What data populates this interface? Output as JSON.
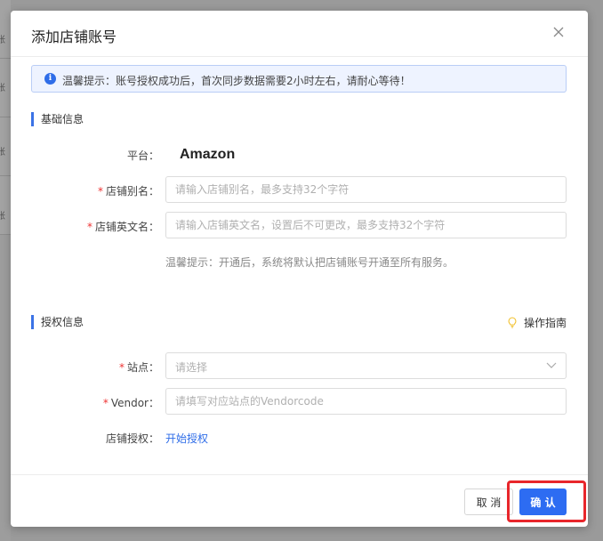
{
  "background": {
    "edge_chars": [
      "账",
      "账",
      "账",
      "账"
    ]
  },
  "modal": {
    "title": "添加店铺账号",
    "close_icon": "close-icon"
  },
  "alert": {
    "icon": "info-icon",
    "text": "温馨提示：账号授权成功后，首次同步数据需要2小时左右，请耐心等待！"
  },
  "basic_section": {
    "title": "基础信息",
    "platform_label": "平台：",
    "platform_value": "Amazon",
    "alias_label": "店铺别名：",
    "alias_placeholder": "请输入店铺别名，最多支持32个字符",
    "english_label": "店铺英文名：",
    "english_placeholder": "请输入店铺英文名，设置后不可更改，最多支持32个字符",
    "tip": "温馨提示：开通后，系统将默认把店铺账号开通至所有服务。"
  },
  "auth_section": {
    "title": "授权信息",
    "guide_label": "操作指南",
    "guide_icon": "lightbulb-icon",
    "site_label": "站点：",
    "site_placeholder": "请选择",
    "vendor_label": "Vendor：",
    "vendor_placeholder": "请填写对应站点的Vendorcode",
    "store_auth_label": "店铺授权：",
    "store_auth_link": "开始授权"
  },
  "footer": {
    "cancel_label": "取 消",
    "confirm_label": "确 认"
  },
  "colors": {
    "primary": "#2d6cf2",
    "required": "#e33333",
    "highlight": "#e8262b",
    "section_bar": "#3b73e6"
  }
}
